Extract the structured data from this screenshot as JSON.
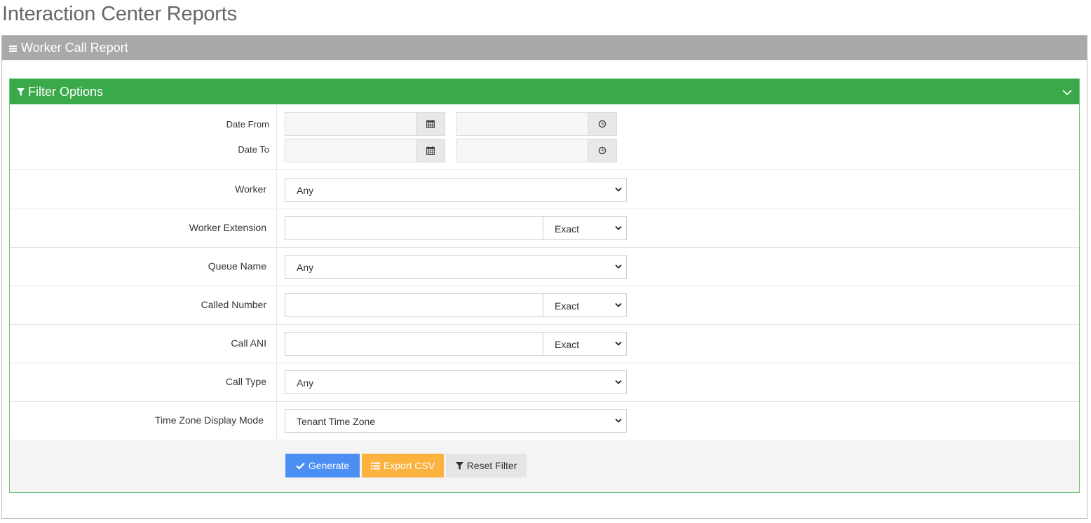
{
  "page": {
    "title": "Interaction Center Reports"
  },
  "panel": {
    "title": "Worker Call Report"
  },
  "filter": {
    "title": "Filter Options",
    "date_from_label": "Date From",
    "date_to_label": "Date To",
    "worker_label": "Worker",
    "worker_value": "Any",
    "worker_extension_label": "Worker Extension",
    "worker_extension_mode": "Exact",
    "queue_name_label": "Queue Name",
    "queue_name_value": "Any",
    "called_number_label": "Called Number",
    "called_number_mode": "Exact",
    "call_ani_label": "Call ANI",
    "call_ani_mode": "Exact",
    "call_type_label": "Call Type",
    "call_type_value": "Any",
    "tz_label": "Time Zone Display Mode",
    "tz_value": "Tenant Time Zone"
  },
  "buttons": {
    "generate": "Generate",
    "export": "Export CSV",
    "reset": "Reset Filter"
  },
  "icons": {
    "menu": "hamburger-icon",
    "filter": "filter-icon",
    "collapse": "chevron-down-icon",
    "calendar": "calendar-icon",
    "clock": "clock-icon",
    "check": "check-icon",
    "list": "list-icon"
  },
  "colors": {
    "panel_header": "#a9a9a9",
    "filter_header": "#3aa94a",
    "generate": "#4b8ff2",
    "export": "#fbb23e",
    "reset": "#e5e5e5"
  }
}
